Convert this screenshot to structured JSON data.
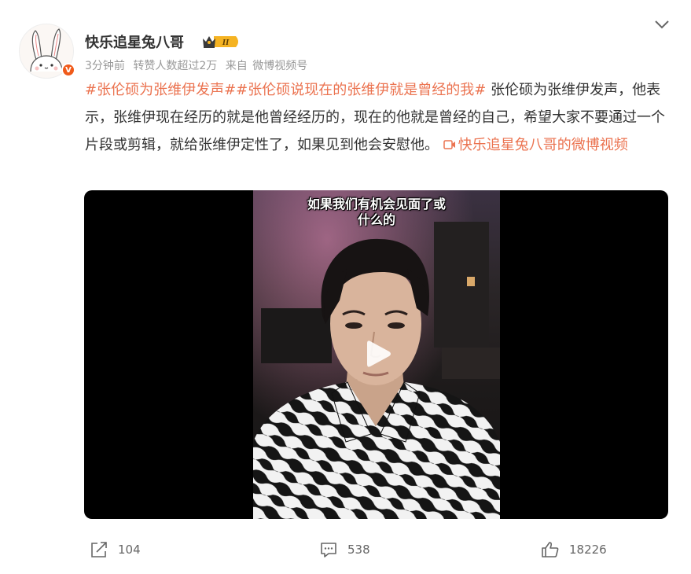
{
  "post": {
    "author": "快乐追星兔八哥",
    "time": "3分钟前",
    "repost_info": "转赞人数超过2万",
    "source_prefix": "来自",
    "source_app": "微博视频号",
    "topic1": "#张伦硕为张维伊发声#",
    "topic2": "#张伦硕说现在的张维伊就是曾经的我#",
    "body": " 张伦硕为张维伊发声，他表示，张维伊现在经历的就是他曾经经历的，现在的他就是曾经的自己，希望大家不要通过一个片段或剪辑，就给张维伊定性了，如果见到他会安慰他。",
    "video_source_link": "快乐追星兔八哥的微博视频"
  },
  "video": {
    "caption_line1": "如果我们有机会见面了或",
    "caption_line2": "什么的"
  },
  "actions": {
    "share_count": "104",
    "comment_count": "538",
    "like_count": "18226"
  },
  "badge": {
    "vip_level": "II",
    "verified_mark": "V"
  },
  "colors": {
    "topic": "#eb7350",
    "badge_orange": "#f05a1a",
    "badge_gold": "#f5b322"
  }
}
